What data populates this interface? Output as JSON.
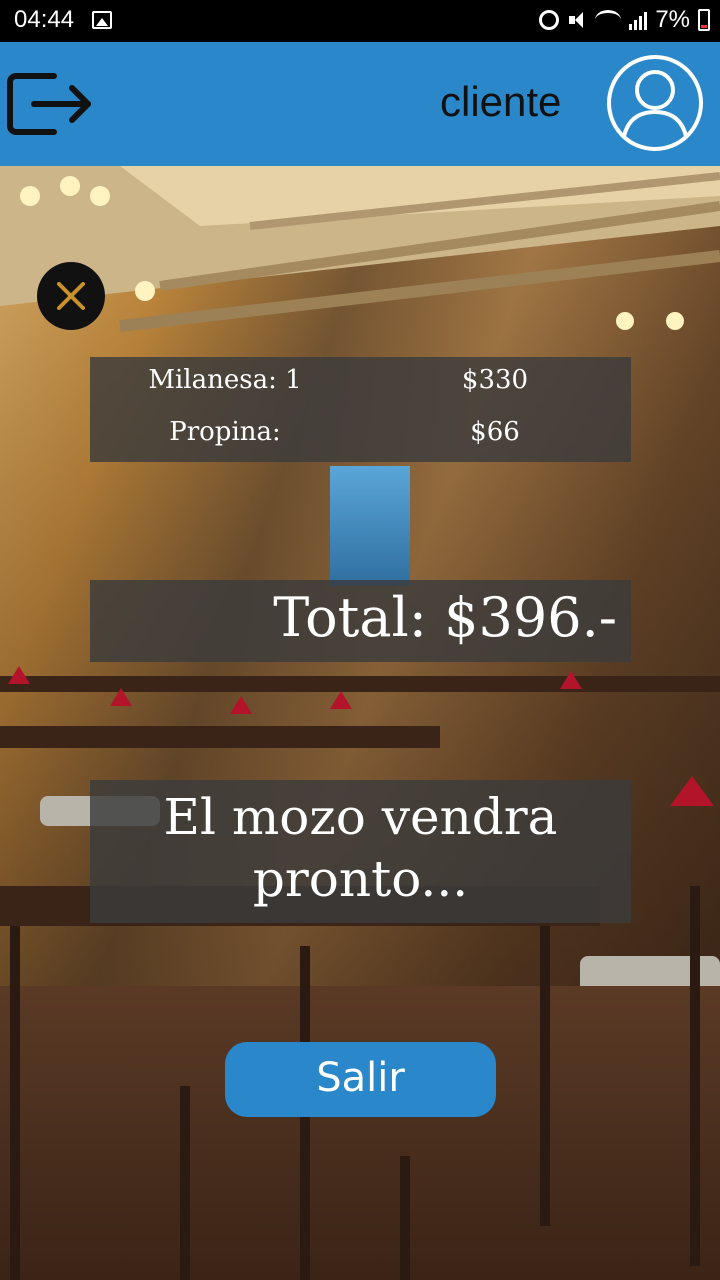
{
  "status_bar": {
    "time": "04:44",
    "battery": "7%"
  },
  "header": {
    "user_label": "cliente",
    "background_color": "#2a87c9"
  },
  "order": {
    "items": [
      {
        "name": "Milanesa: 1",
        "price": "$330"
      },
      {
        "name": "Propina:",
        "price": "$66"
      }
    ],
    "total": "Total: $396.-"
  },
  "message": "El mozo vendra pronto...",
  "buttons": {
    "salir": "Salir"
  },
  "icons": {
    "logout": "logout-icon",
    "avatar": "user-avatar-icon",
    "close": "close-icon",
    "gallery": "gallery-icon",
    "alarm": "alarm-icon",
    "mute": "mute-icon",
    "wifi": "wifi-icon",
    "signal": "signal-icon",
    "battery": "battery-icon"
  }
}
